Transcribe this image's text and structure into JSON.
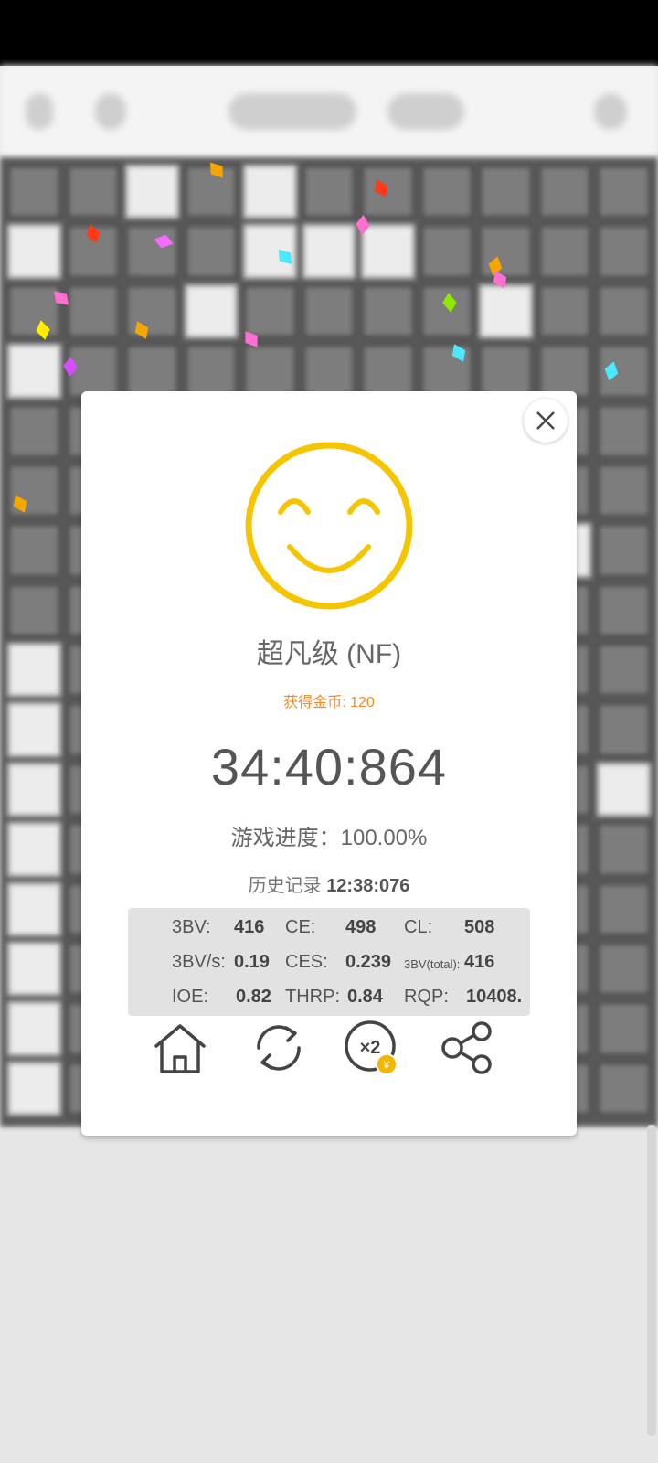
{
  "dialog": {
    "rank": "超凡级 (NF)",
    "coins": "获得金币: 120",
    "time": "34:40:864",
    "progress": "游戏进度：100.00%",
    "best_label": "历史记录",
    "best_time": "12:38:076",
    "stats": {
      "bbbv_label": "3BV:",
      "bbbv_value": "416",
      "ce_label": "CE:",
      "ce_value": "498",
      "cl_label": "CL:",
      "cl_value": "508",
      "bbbvs_label": "3BV/s:",
      "bbbvs_value": "0.19",
      "ces_label": "CES:",
      "ces_value": "0.239",
      "bbbv_total_label": "3BV(total):",
      "bbbv_total_value": "416",
      "ioe_label": "IOE:",
      "ioe_value": "0.82",
      "thrp_label": "THRP:",
      "thrp_value": "0.84",
      "rqp_label": "RQP:",
      "rqp_value": "10408."
    },
    "actions": {
      "double_coins_badge": "×2",
      "coin_symbol": "¥"
    }
  },
  "colors": {
    "smiley": "#f5c500",
    "coins": "#f08c28",
    "stats_bg": "#e2e2e2"
  },
  "icons": [
    "close-icon",
    "smiley-icon",
    "home-icon",
    "restart-icon",
    "double-coins-icon",
    "share-icon"
  ]
}
